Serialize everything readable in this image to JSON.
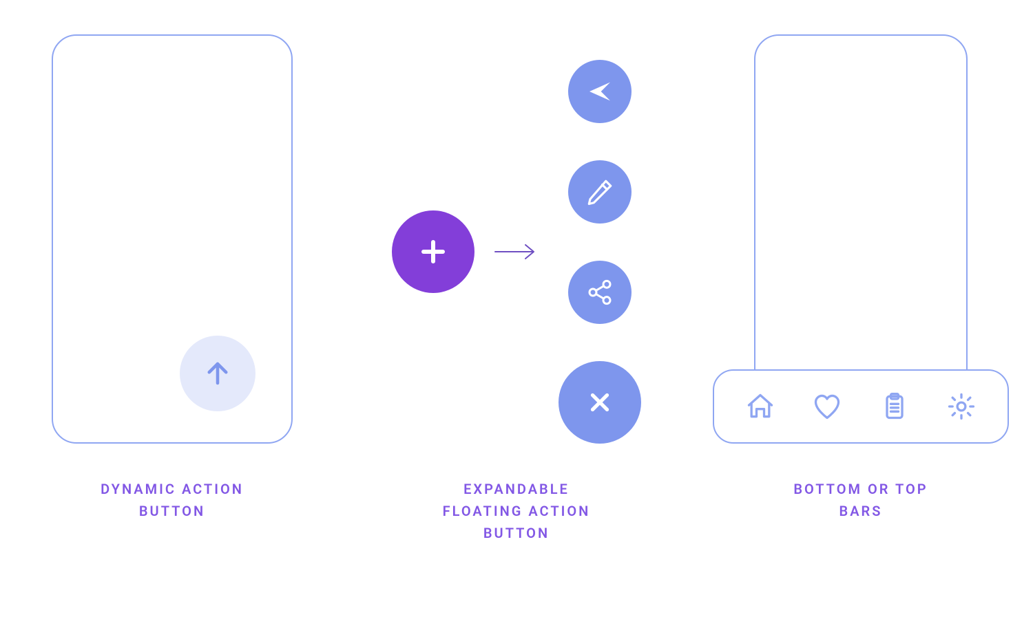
{
  "colors": {
    "outline": "#8fa6f2",
    "fab_blue": "#7e96ed",
    "fab_purple": "#833ed9",
    "arrow_stroke": "#6e4fc2",
    "caption": "#8257e5",
    "dyn_bg": "#e4e9fb"
  },
  "captions": {
    "c1_line1": "DYNAMIC ACTION",
    "c1_line2": "BUTTON",
    "c2_line1": "EXPANDABLE",
    "c2_line2": "FLOATING ACTION",
    "c2_line3": "BUTTON",
    "c3_line1": "BOTTOM OR TOP",
    "c3_line2": "BARS"
  },
  "icons": {
    "dynamic": "arrow-up",
    "fab_collapsed": "plus",
    "fab_expanded_main": "close",
    "fab_items": [
      "share",
      "edit",
      "send"
    ],
    "bottom_bar": [
      "home",
      "heart",
      "clipboard",
      "gear"
    ]
  }
}
